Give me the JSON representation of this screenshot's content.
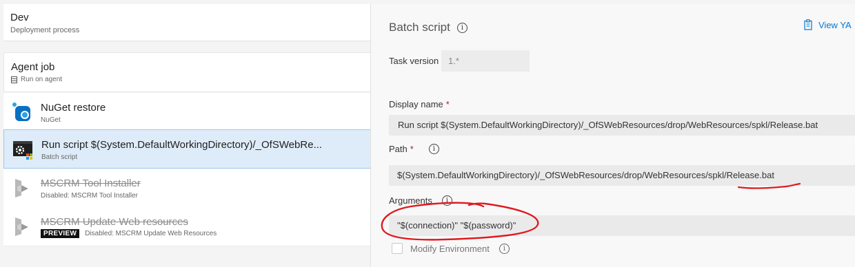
{
  "stage": {
    "title": "Dev",
    "subtitle": "Deployment process"
  },
  "agent_job": {
    "title": "Agent job",
    "subtitle": "Run on agent"
  },
  "tasks": [
    {
      "name": "NuGet restore",
      "subtitle": "NuGet",
      "icon": "nuget-icon",
      "disabled": false,
      "selected": false
    },
    {
      "name": "Run script $(System.DefaultWorkingDirectory)/_OfSWebRe...",
      "subtitle": "Batch script",
      "icon": "batch-script-icon",
      "disabled": false,
      "selected": true
    },
    {
      "name": "MSCRM Tool Installer",
      "subtitle": "Disabled: MSCRM Tool Installer",
      "icon": "dynamics-icon",
      "disabled": true,
      "selected": false
    },
    {
      "name": "MSCRM Update Web resources",
      "subtitle": "Disabled: MSCRM Update Web Resources",
      "badge": "PREVIEW",
      "icon": "dynamics-icon",
      "disabled": true,
      "selected": false
    }
  ],
  "details": {
    "title": "Batch script",
    "view_yaml": "View YA",
    "task_version_label": "Task version",
    "task_version_value": "1.*",
    "display_name_label": "Display name",
    "display_name_value": "Run script $(System.DefaultWorkingDirectory)/_OfSWebResources/drop/WebResources/spkl/Release.bat",
    "path_label": "Path",
    "path_value": "$(System.DefaultWorkingDirectory)/_OfSWebResources/drop/WebResources/spkl/Release.bat",
    "arguments_label": "Arguments",
    "arguments_value": "\"$(connection)\" \"$(password)\"",
    "modify_env_label": "Modify Environment",
    "required_mark": "*"
  },
  "colors": {
    "accent": "#0078d4",
    "selected_bg": "#deecf9",
    "annotation_red": "#e0191f"
  }
}
